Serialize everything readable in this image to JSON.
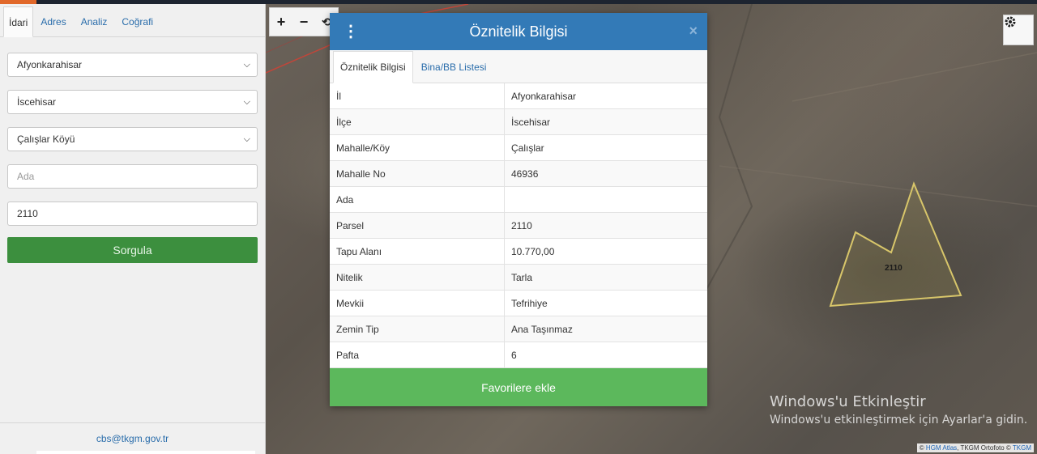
{
  "sidebar": {
    "tabs": [
      "İdari",
      "Adres",
      "Analiz",
      "Coğrafi"
    ],
    "fields": {
      "il": "Afyonkarahisar",
      "ilce": "İscehisar",
      "mahalle": "Çalışlar Köyü",
      "ada_placeholder": "Ada",
      "parsel": "2110"
    },
    "submit_label": "Sorgula",
    "footer_email": "cbs@tkgm.gov.tr"
  },
  "map": {
    "zoom_in": "+",
    "zoom_out": "−",
    "refresh": "⟲",
    "parcel_label": "2110",
    "watermark_line1": "Windows'u Etkinleştir",
    "watermark_line2": "Windows'u etkinleştirmek için Ayarlar'a gidin.",
    "attribution": {
      "prefix": "©",
      "hgm": "HGM Atlas",
      "mid": ", TKGM Ortofoto ©",
      "tkgm": "TKGM"
    }
  },
  "modal": {
    "title": "Öznitelik Bilgisi",
    "close": "×",
    "menu": "⋮",
    "tabs": [
      "Öznitelik Bilgisi",
      "Bina/BB Listesi"
    ],
    "rows": [
      {
        "key": "İl",
        "value": "Afyonkarahisar"
      },
      {
        "key": "İlçe",
        "value": "İscehisar"
      },
      {
        "key": "Mahalle/Köy",
        "value": "Çalışlar"
      },
      {
        "key": "Mahalle No",
        "value": "46936"
      },
      {
        "key": "Ada",
        "value": ""
      },
      {
        "key": "Parsel",
        "value": "2110"
      },
      {
        "key": "Tapu Alanı",
        "value": "10.770,00"
      },
      {
        "key": "Nitelik",
        "value": "Tarla"
      },
      {
        "key": "Mevkii",
        "value": "Tefrihiye"
      },
      {
        "key": "Zemin Tip",
        "value": "Ana Taşınmaz"
      },
      {
        "key": "Pafta",
        "value": "6"
      }
    ],
    "favorite_label": "Favorilere ekle"
  },
  "colors": {
    "header_blue": "#337ab7",
    "green_button": "#5cb85c",
    "sorgula_green": "#3c8f3e",
    "parcel_outline": "#d8c66a",
    "top_accent": "#e1682a"
  }
}
